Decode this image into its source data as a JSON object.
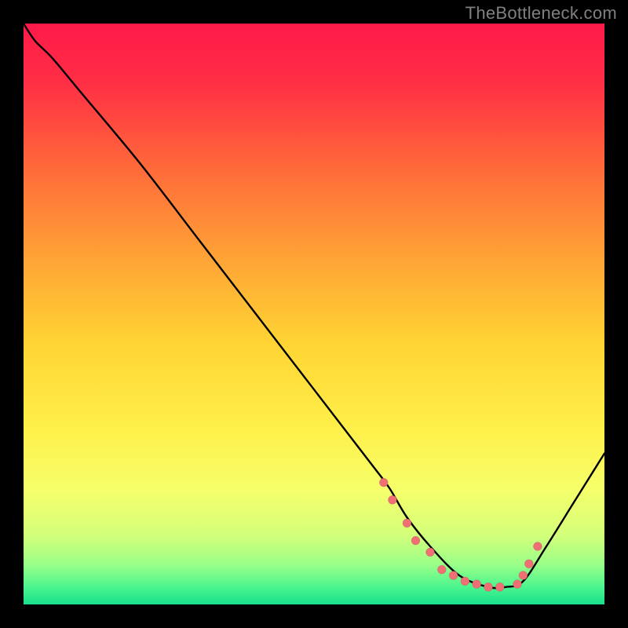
{
  "watermark": "TheBottleneck.com",
  "chart_data": {
    "type": "line",
    "title": "",
    "xlabel": "",
    "ylabel": "",
    "xlim": [
      0,
      100
    ],
    "ylim": [
      0,
      100
    ],
    "series": [
      {
        "name": "bottleneck-curve",
        "x": [
          0,
          2,
          5,
          10,
          20,
          30,
          40,
          50,
          60,
          63,
          66,
          70,
          75,
          80,
          83,
          86,
          90,
          95,
          100
        ],
        "y": [
          100,
          97,
          94,
          88,
          76,
          63,
          50,
          37,
          24,
          20,
          15,
          10,
          5,
          3,
          3,
          4,
          10,
          18,
          26
        ]
      }
    ],
    "markers": {
      "name": "highlight-points",
      "x": [
        62,
        63.5,
        66,
        67.5,
        70,
        72,
        74,
        76,
        78,
        80,
        82,
        85,
        86,
        87,
        88.5
      ],
      "y": [
        21,
        18,
        14,
        11,
        9,
        6,
        5,
        4,
        3.5,
        3,
        3,
        3.5,
        5,
        7,
        10
      ]
    },
    "gradient_stops": [
      {
        "offset": 0.0,
        "color": "#ff1a4a"
      },
      {
        "offset": 0.1,
        "color": "#ff2e45"
      },
      {
        "offset": 0.25,
        "color": "#ff6a3a"
      },
      {
        "offset": 0.4,
        "color": "#ffa236"
      },
      {
        "offset": 0.55,
        "color": "#ffd433"
      },
      {
        "offset": 0.7,
        "color": "#fff04a"
      },
      {
        "offset": 0.8,
        "color": "#f6ff6a"
      },
      {
        "offset": 0.88,
        "color": "#d4ff7a"
      },
      {
        "offset": 0.93,
        "color": "#9cff88"
      },
      {
        "offset": 0.97,
        "color": "#4cf58e"
      },
      {
        "offset": 1.0,
        "color": "#18e08a"
      }
    ]
  }
}
